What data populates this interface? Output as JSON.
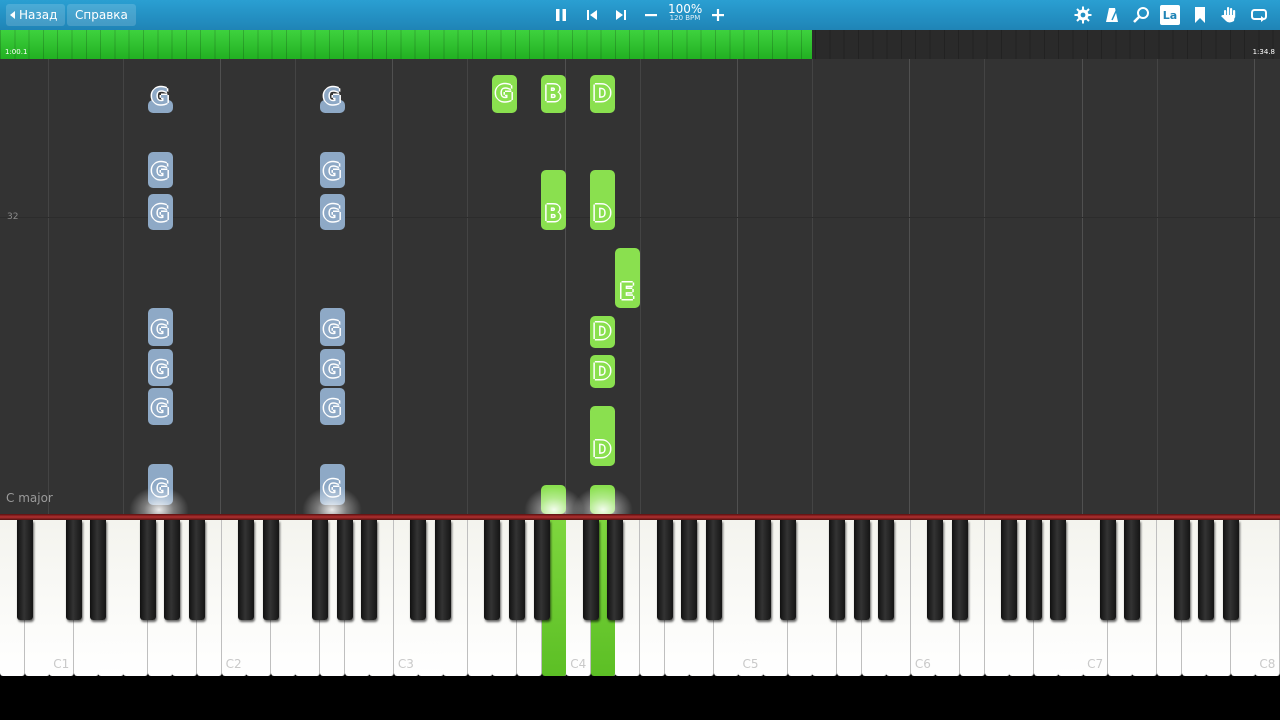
{
  "topbar": {
    "back_label": "Назад",
    "help_label": "Справка",
    "tempo_percent": "100%",
    "tempo_bpm": "120 BPM",
    "icons_center": [
      "pause-icon",
      "skip-back-icon",
      "skip-forward-icon",
      "tempo-minus-icon",
      "tempo-plus-icon"
    ],
    "icons_right": [
      "settings-gear-icon",
      "metronome-icon",
      "search-icon",
      "note-labels-icon",
      "bookmark-icon",
      "hand-icon",
      "loop-icon"
    ],
    "note_labels_text": "La"
  },
  "timeline": {
    "current": "1:00.1",
    "total": "1:34.8",
    "progress": 0.634
  },
  "roll": {
    "measure_number": "32",
    "key_signature": "C major",
    "notes": [
      {
        "name": "G",
        "color": "blue",
        "pitch": "C2",
        "start": 100,
        "end": 113
      },
      {
        "name": "G",
        "color": "blue",
        "pitch": "C3",
        "start": 100,
        "end": 113
      },
      {
        "name": "G",
        "color": "blue",
        "pitch": "C2",
        "start": 152,
        "end": 188
      },
      {
        "name": "G",
        "color": "blue",
        "pitch": "C3",
        "start": 152,
        "end": 188
      },
      {
        "name": "G",
        "color": "blue",
        "pitch": "C2",
        "start": 194,
        "end": 230
      },
      {
        "name": "G",
        "color": "blue",
        "pitch": "C3",
        "start": 194,
        "end": 230
      },
      {
        "name": "G",
        "color": "blue",
        "pitch": "C2",
        "start": 308,
        "end": 346
      },
      {
        "name": "G",
        "color": "blue",
        "pitch": "C3",
        "start": 308,
        "end": 346
      },
      {
        "name": "G",
        "color": "blue",
        "pitch": "C2",
        "start": 349,
        "end": 386
      },
      {
        "name": "G",
        "color": "blue",
        "pitch": "C3",
        "start": 349,
        "end": 386
      },
      {
        "name": "G",
        "color": "blue",
        "pitch": "C2",
        "start": 388,
        "end": 425
      },
      {
        "name": "G",
        "color": "blue",
        "pitch": "C3",
        "start": 388,
        "end": 425
      },
      {
        "name": "G",
        "color": "blue",
        "pitch": "C2",
        "start": 464,
        "end": 505
      },
      {
        "name": "G",
        "color": "blue",
        "pitch": "C3",
        "start": 464,
        "end": 505
      },
      {
        "name": "G",
        "color": "green",
        "pitch": "C4_G",
        "start": 100,
        "end": 113
      },
      {
        "name": "B",
        "color": "green",
        "pitch": "C4_B",
        "start": 100,
        "end": 113
      },
      {
        "name": "D",
        "color": "green",
        "pitch": "C4_D",
        "start": 100,
        "end": 113
      },
      {
        "name": "G",
        "color": "green",
        "pitch": "C4_G",
        "start": 75,
        "end": 110
      },
      {
        "name": "B",
        "color": "green",
        "pitch": "C4_B",
        "start": 75,
        "end": 110
      },
      {
        "name": "D",
        "color": "green",
        "pitch": "C4_D",
        "start": 75,
        "end": 110
      },
      {
        "name": "B",
        "color": "green",
        "pitch": "C4_B",
        "start": 170,
        "end": 230
      },
      {
        "name": "D",
        "color": "green",
        "pitch": "C4_D",
        "start": 170,
        "end": 230
      },
      {
        "name": "E",
        "color": "green",
        "pitch": "C4_E",
        "start": 248,
        "end": 308
      },
      {
        "name": "D",
        "color": "green",
        "pitch": "C4_D",
        "start": 316,
        "end": 348
      },
      {
        "name": "D",
        "color": "green",
        "pitch": "C4_D",
        "start": 355,
        "end": 388
      },
      {
        "name": "D",
        "color": "green",
        "pitch": "C4_D",
        "start": 406,
        "end": 466
      },
      {
        "name": "",
        "color": "green",
        "pitch": "C4_B",
        "start": 485,
        "end": 514
      },
      {
        "name": "",
        "color": "green",
        "pitch": "C4_D",
        "start": 485,
        "end": 514
      }
    ]
  },
  "keyboard": {
    "octave_labels": [
      "C1",
      "C2",
      "C3",
      "C4",
      "C5",
      "C6",
      "C7",
      "C8"
    ],
    "active_keys": [
      "B3",
      "D4"
    ]
  }
}
